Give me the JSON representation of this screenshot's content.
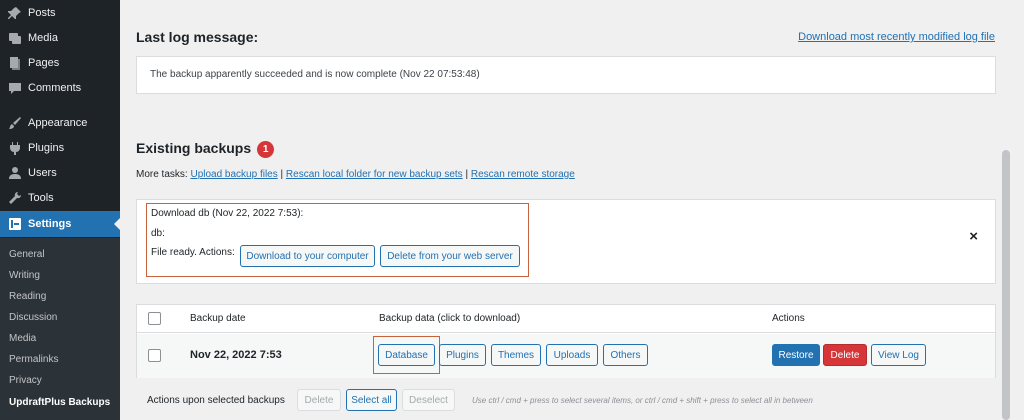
{
  "sidebar": {
    "items": [
      {
        "label": "Posts",
        "icon": "pin-icon"
      },
      {
        "label": "Media",
        "icon": "media-icon"
      },
      {
        "label": "Pages",
        "icon": "pages-icon"
      },
      {
        "label": "Comments",
        "icon": "comments-icon"
      },
      {
        "label": "Appearance",
        "icon": "brush-icon"
      },
      {
        "label": "Plugins",
        "icon": "plugins-icon"
      },
      {
        "label": "Users",
        "icon": "users-icon"
      },
      {
        "label": "Tools",
        "icon": "wrench-icon"
      },
      {
        "label": "Settings",
        "icon": "settings-icon"
      }
    ],
    "submenu": [
      "General",
      "Writing",
      "Reading",
      "Discussion",
      "Media",
      "Permalinks",
      "Privacy",
      "UpdraftPlus Backups"
    ]
  },
  "log": {
    "title": "Last log message:",
    "download_link": "Download most recently modified log file",
    "message": "The backup apparently succeeded and is now complete (Nov 22 07:53:48)"
  },
  "existing": {
    "title": "Existing backups",
    "count": "1",
    "more_tasks_label": "More tasks:",
    "task_upload": "Upload backup files",
    "task_rescan_local": "Rescan local folder for new backup sets",
    "task_rescan_remote": "Rescan remote storage",
    "separator": "|"
  },
  "download_panel": {
    "title": "Download db (Nov 22, 2022 7:53):",
    "item": "db:",
    "ready_text": "File ready. Actions:",
    "btn_download": "Download to your computer",
    "btn_delete": "Delete from your web server",
    "close": "×"
  },
  "table": {
    "headers": {
      "date": "Backup date",
      "data": "Backup data (click to download)",
      "actions": "Actions"
    },
    "row": {
      "date": "Nov 22, 2022 7:53",
      "data_buttons": [
        "Database",
        "Plugins",
        "Themes",
        "Uploads",
        "Others"
      ],
      "restore": "Restore",
      "delete": "Delete",
      "view_log": "View Log"
    }
  },
  "footer": {
    "label": "Actions upon selected backups",
    "delete": "Delete",
    "select_all": "Select all",
    "deselect": "Deselect",
    "hint": "Use ctrl / cmd + press to select several items, or ctrl / cmd + shift + press to select all in between"
  }
}
